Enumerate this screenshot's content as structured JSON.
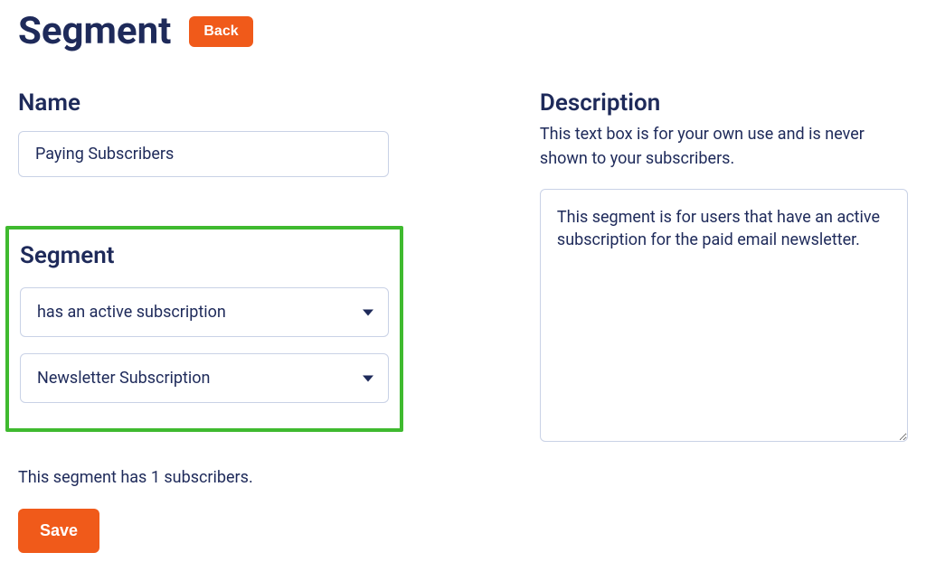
{
  "header": {
    "title": "Segment",
    "back_label": "Back"
  },
  "name": {
    "label": "Name",
    "value": "Paying Subscribers"
  },
  "segment": {
    "label": "Segment",
    "condition_select": "has an active subscription",
    "product_select": "Newsletter Subscription"
  },
  "description": {
    "label": "Description",
    "help": "This text box is for your own use and is never shown to your subscribers.",
    "value": "This segment is for users that have an active subscription for the paid email newsletter."
  },
  "status": {
    "text": "This segment has 1 subscribers."
  },
  "actions": {
    "save_label": "Save"
  }
}
